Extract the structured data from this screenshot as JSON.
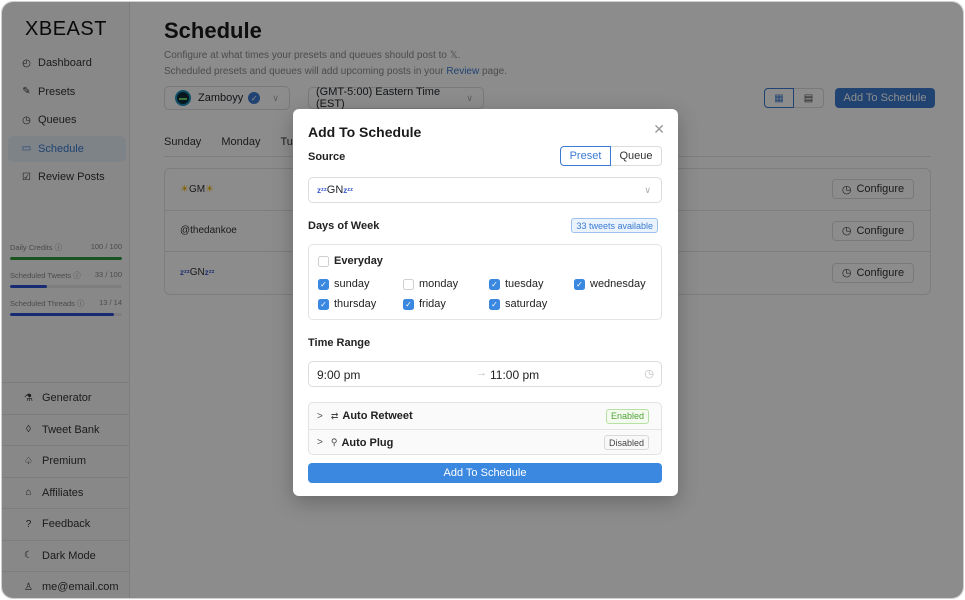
{
  "sidebar": {
    "logo": "XBEAST",
    "nav": [
      {
        "label": "Dashboard",
        "icon": "◴",
        "active": false
      },
      {
        "label": "Presets",
        "icon": "✎",
        "active": false
      },
      {
        "label": "Queues",
        "icon": "◷",
        "active": false
      },
      {
        "label": "Schedule",
        "icon": "▭",
        "active": true
      },
      {
        "label": "Review Posts",
        "icon": "☑",
        "active": false
      }
    ],
    "credits": [
      {
        "label": "Daily Credits ⓘ",
        "value": "100 / 100",
        "fraction": 1.0,
        "color": "#2e9a3a"
      },
      {
        "label": "Scheduled Tweets ⓘ",
        "value": "33 / 100",
        "fraction": 0.33,
        "color": "#2a4fd0"
      },
      {
        "label": "Scheduled Threads ⓘ",
        "value": "13 / 14",
        "fraction": 0.93,
        "color": "#2a4fd0"
      }
    ],
    "bottom": [
      {
        "label": "Generator",
        "icon": "⚗"
      },
      {
        "label": "Tweet Bank",
        "icon": "◊"
      },
      {
        "label": "Premium",
        "icon": "♤"
      },
      {
        "label": "Affiliates",
        "icon": "⌂"
      },
      {
        "label": "Feedback",
        "icon": "?"
      },
      {
        "label": "Dark Mode",
        "icon": "☾"
      },
      {
        "label": "me@email.com",
        "icon": "♙"
      }
    ]
  },
  "main": {
    "title": "Schedule",
    "subtitle_line1": "Configure at what times your presets and queues should post to 𝕏.",
    "subtitle_line2_pre": "Scheduled presets and queues will add upcoming posts in your ",
    "subtitle_link": "Review",
    "subtitle_line2_post": " page.",
    "account": {
      "name": "Zamboyy",
      "verified_icon": "✓",
      "chevron": "∨"
    },
    "timezone": "(GMT-5:00) Eastern Time (EST)",
    "timezone_chevron": "∨",
    "view_icons": {
      "calendar": "▦",
      "list": "▤"
    },
    "add_button": "Add To Schedule",
    "day_tabs": [
      "Sunday",
      "Monday",
      "Tue"
    ],
    "rows": [
      {
        "pre": "☀",
        "label": " GM ",
        "post": "☀",
        "type": "sun"
      },
      {
        "pre": "",
        "label": "@thedankoe",
        "post": "",
        "type": "plain"
      },
      {
        "pre": "zᶻᶻ",
        "label": " GN ",
        "post": "zᶻᶻ",
        "type": "zz"
      }
    ],
    "configure_label": "Configure",
    "configure_icon": "◷"
  },
  "modal": {
    "title": "Add To Schedule",
    "close_icon": "✕",
    "source_label": "Source",
    "source_options": [
      "Preset",
      "Queue"
    ],
    "source_selected": "Preset",
    "source_value_pre": "zᶻᶻ",
    "source_value": " GN ",
    "source_value_post": "zᶻᶻ",
    "source_chevron": "∨",
    "days_label": "Days of Week",
    "tweets_available": "33 tweets available",
    "everyday_label": "Everyday",
    "everyday_checked": false,
    "days": [
      {
        "label": "sunday",
        "checked": true
      },
      {
        "label": "monday",
        "checked": false
      },
      {
        "label": "tuesday",
        "checked": true
      },
      {
        "label": "wednesday",
        "checked": true
      },
      {
        "label": "thursday",
        "checked": true
      },
      {
        "label": "friday",
        "checked": true
      },
      {
        "label": "saturday",
        "checked": true
      }
    ],
    "time_label": "Time Range",
    "time_start": "9:00 pm",
    "time_arrow": "→",
    "time_end": "11:00 pm",
    "time_icon": "◷",
    "options": [
      {
        "label": "Auto Retweet",
        "icon": "⇄",
        "status": "Enabled"
      },
      {
        "label": "Auto Plug",
        "icon": "⚲",
        "status": "Disabled"
      }
    ],
    "expand_chevron": ">",
    "submit_label": "Add To Schedule"
  },
  "colors": {
    "accent": "#3b7bd0",
    "enabled": "#52a33a",
    "credit_green": "#2e9a3a",
    "credit_blue": "#2a4fd0"
  }
}
